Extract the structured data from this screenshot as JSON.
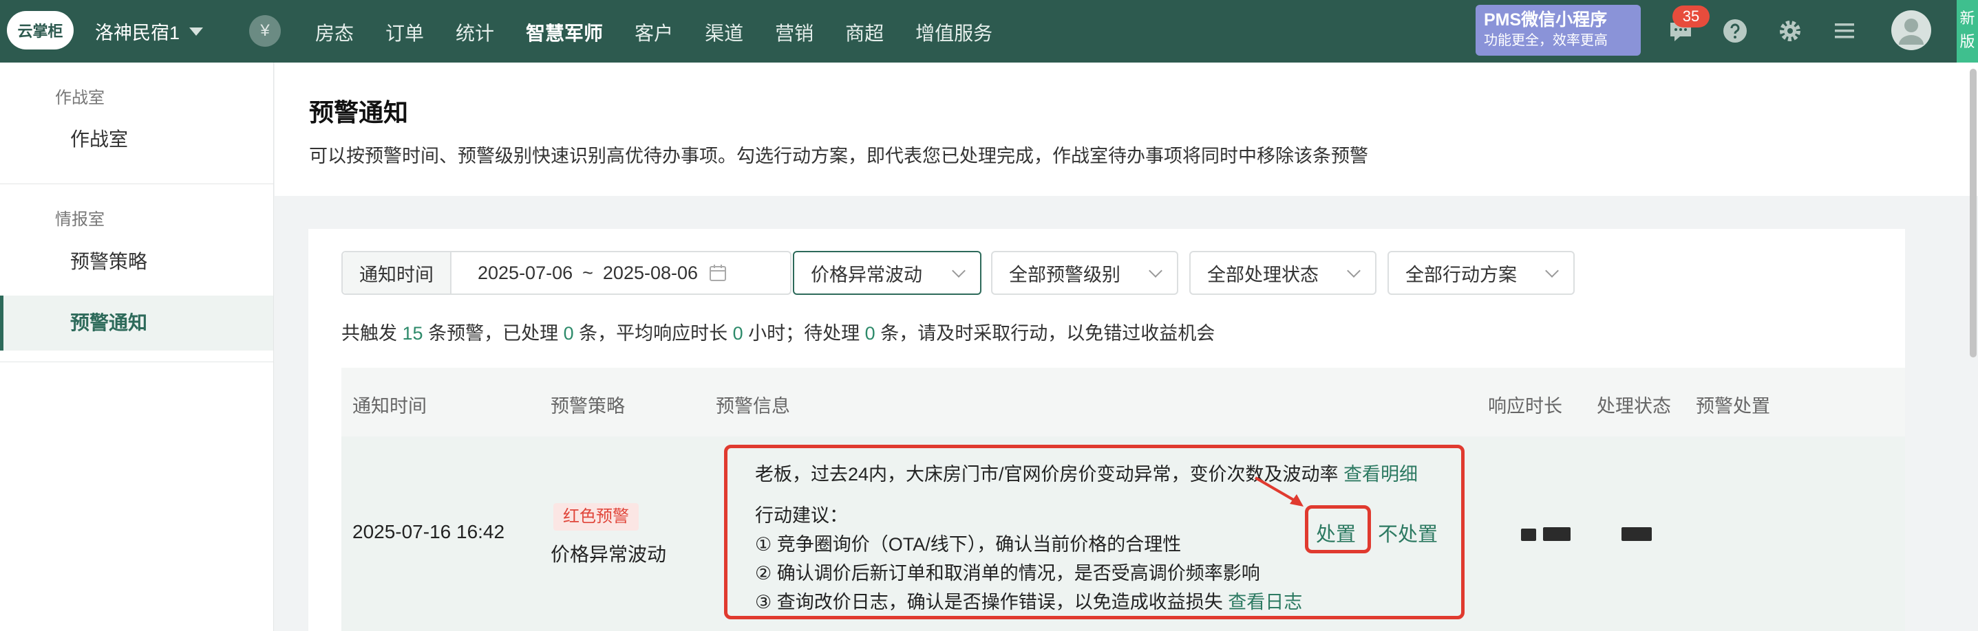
{
  "topbar": {
    "logo_text": "云掌柜",
    "hotel_name": "洛神民宿1",
    "yen_icon": "¥",
    "nav": [
      {
        "label": "房态",
        "active": false
      },
      {
        "label": "订单",
        "active": false
      },
      {
        "label": "统计",
        "active": false
      },
      {
        "label": "智慧军师",
        "active": true
      },
      {
        "label": "客户",
        "active": false
      },
      {
        "label": "渠道",
        "active": false
      },
      {
        "label": "营销",
        "active": false
      },
      {
        "label": "商超",
        "active": false
      },
      {
        "label": "增值服务",
        "active": false
      }
    ],
    "pms_line1": "PMS微信小程序",
    "pms_line2": "功能更全，效率更高",
    "message_badge": "35",
    "new_tag_line1": "新",
    "new_tag_line2": "版",
    "colors": {
      "bar": "#2d5a4f",
      "badge": "#e74c3c",
      "pms": "#8a93d8",
      "new_tag": "#3fbf8e"
    }
  },
  "sidebar": {
    "sections": [
      {
        "title": "作战室",
        "items": [
          {
            "label": "作战室",
            "active": false
          }
        ]
      },
      {
        "title": "情报室",
        "items": [
          {
            "label": "预警策略",
            "active": false
          },
          {
            "label": "预警通知",
            "active": true
          }
        ]
      }
    ]
  },
  "page": {
    "title": "预警通知",
    "description": "可以按预警时间、预警级别快速识别高优待办事项。勾选行动方案，即代表您已处理完成，作战室待办事项将同时中移除该条预警"
  },
  "filters": {
    "time_label": "通知时间",
    "date_start": "2025-07-06",
    "date_sep": "~",
    "date_end": "2025-08-06",
    "strategy": "价格异常波动",
    "level": "全部预警级别",
    "status": "全部处理状态",
    "action": "全部行动方案"
  },
  "summary": {
    "p1": "共触发 ",
    "total": "15",
    "p2": " 条预警，已处理 ",
    "handled": "0",
    "p3": " 条，平均响应时长 ",
    "avg_hours": "0",
    "p4": " 小时；待处理 ",
    "pending": "0",
    "p5": " 条，请及时采取行动，以免错过收益机会"
  },
  "table": {
    "headers": {
      "time": "通知时间",
      "strategy": "预警策略",
      "info": "预警信息",
      "response": "响应时长",
      "status": "处理状态",
      "handle": "预警处置"
    },
    "rows": [
      {
        "time": "2025-07-16 16:42",
        "level_tag": "红色预警",
        "strategy": "价格异常波动",
        "info_main": "老板，过去24内，大床房门市/官网价房价变动异常，变价次数及波动率",
        "info_link": "查看明细",
        "advice_title": "行动建议：",
        "advice_1": "① 竞争圈询价（OTA/线下），确认当前价格的合理性",
        "advice_2": "② 确认调价后新订单和取消单的情况，是否受高调价频率影响",
        "advice_3": "③ 查询改价日志，确认是否操作错误，以免造成收益损失",
        "advice_3_link": "查看日志",
        "action_handle": "处置",
        "action_ignore": "不处置"
      }
    ]
  }
}
